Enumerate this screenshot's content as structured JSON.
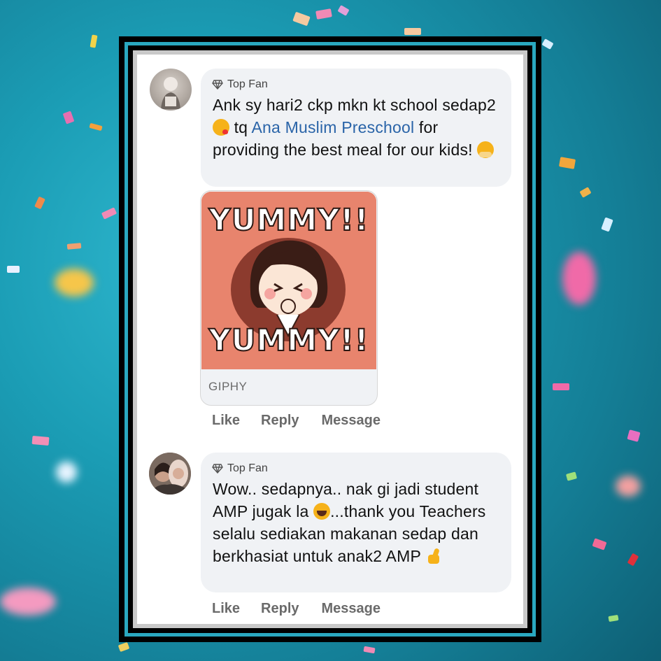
{
  "comments": [
    {
      "badge": "Top Fan",
      "text_before": "Ank sy hari2 ckp mkn kt school sedap2 ",
      "text_mid": " tq ",
      "mention": "Ana Muslim Preschool",
      "text_after": " for providing the best meal for our kids! ",
      "gif": {
        "caption_top": "YUMMY!!",
        "caption_bottom": "YUMMY!!",
        "source": "GIPHY"
      },
      "actions": {
        "like": "Like",
        "reply": "Reply",
        "message": "Message"
      }
    },
    {
      "badge": "Top Fan",
      "text_before": "Wow.. sedapnya.. nak gi jadi student AMP jugak la ",
      "text_after": "...thank you Teachers selalu sediakan makanan sedap dan berkhasiat untuk anak2 AMP ",
      "actions": {
        "like": "Like",
        "reply": "Reply",
        "message": "Message"
      }
    }
  ],
  "icons": {
    "badge": "diamond-icon",
    "emoji_1": "kissing-face-emoji",
    "emoji_2": "hugging-face-emoji",
    "emoji_3": "laughing-tears-emoji",
    "emoji_4": "thumbs-up-emoji"
  },
  "colors": {
    "background": "#1b9db5",
    "frame": "#000000",
    "frame_accent": "#2aa8c0",
    "bubble": "#f0f2f5",
    "link": "#2a64a8",
    "gif_background": "#e8846d"
  }
}
